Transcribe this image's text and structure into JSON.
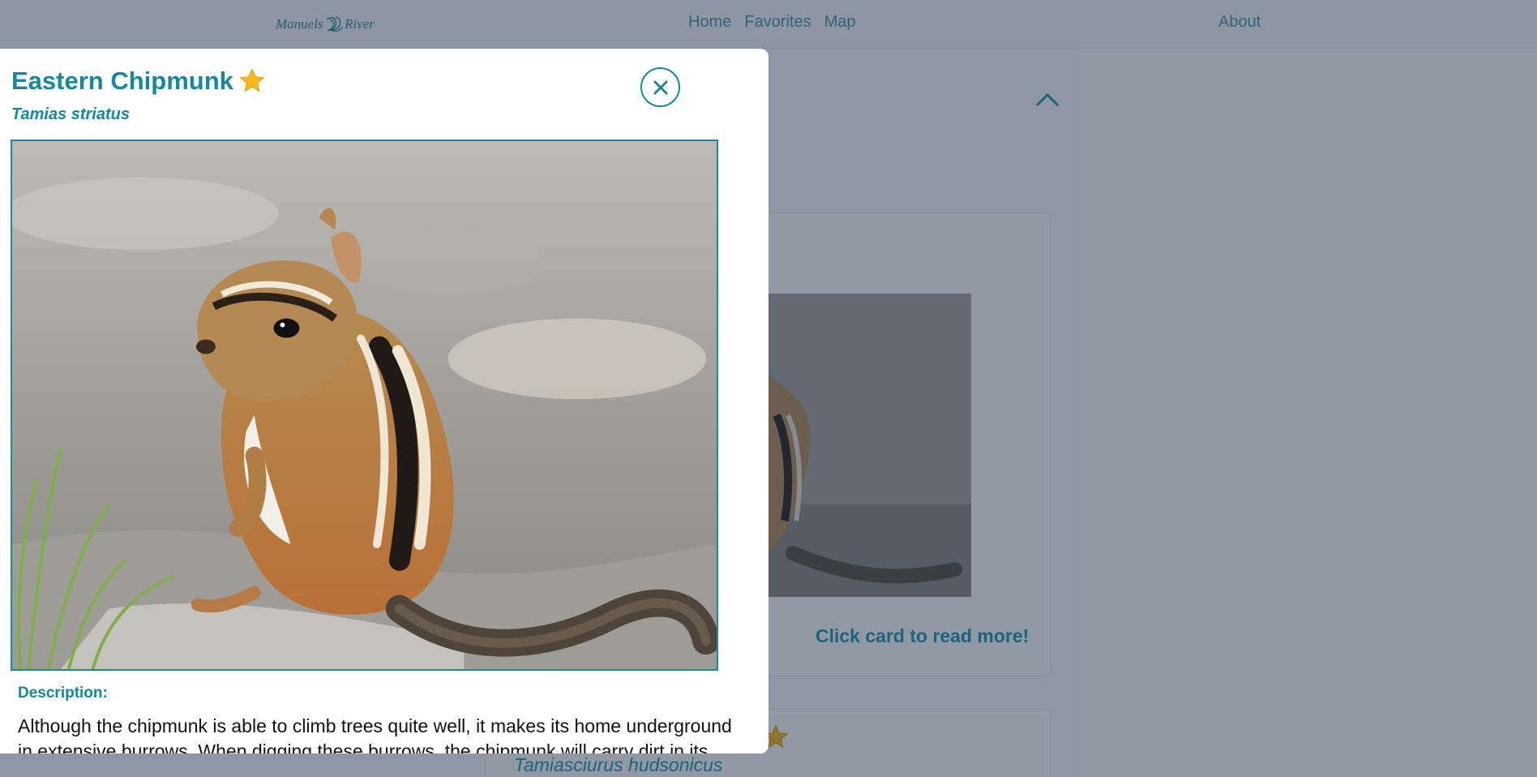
{
  "nav": {
    "logo_left": "Manuels",
    "logo_right": "River",
    "home": "Home",
    "favorites": "Favorites",
    "map": "Map",
    "about": "About"
  },
  "background": {
    "card_readmore": "Click card to read more!",
    "card2_scientific": "Tamiasciurus hudsonicus"
  },
  "modal": {
    "title": "Eastern Chipmunk",
    "scientific_name": "Tamias striatus",
    "favorite_state": "starred",
    "close_icon": "close-icon",
    "description_heading": "Description:",
    "description_text": "Although the chipmunk is able to climb trees quite well, it makes its home underground in extensive burrows. When digging these burrows, the chipmunk will carry dirt in its"
  },
  "colors": {
    "accent": "#17879b",
    "star": "#f5b921",
    "overlay": "#1a2942"
  }
}
